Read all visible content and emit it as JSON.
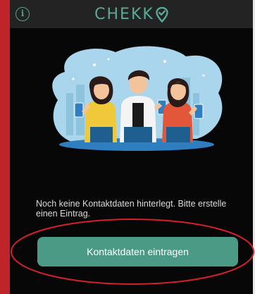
{
  "header": {
    "logo_text": "CHEKK",
    "info_icon": "info-icon"
  },
  "empty_state": {
    "message": "Noch keine Kontaktdaten hinterlegt. Bitte erstelle einen Eintrag."
  },
  "actions": {
    "add_contact_label": "Kontaktdaten eintragen"
  },
  "colors": {
    "background": "#070707",
    "topbar": "#232323",
    "accent": "#4a9a86",
    "annotation_red": "#d4202a"
  },
  "icons": [
    "info-icon",
    "logo-pin-icon",
    "people-with-phones-illustration"
  ]
}
